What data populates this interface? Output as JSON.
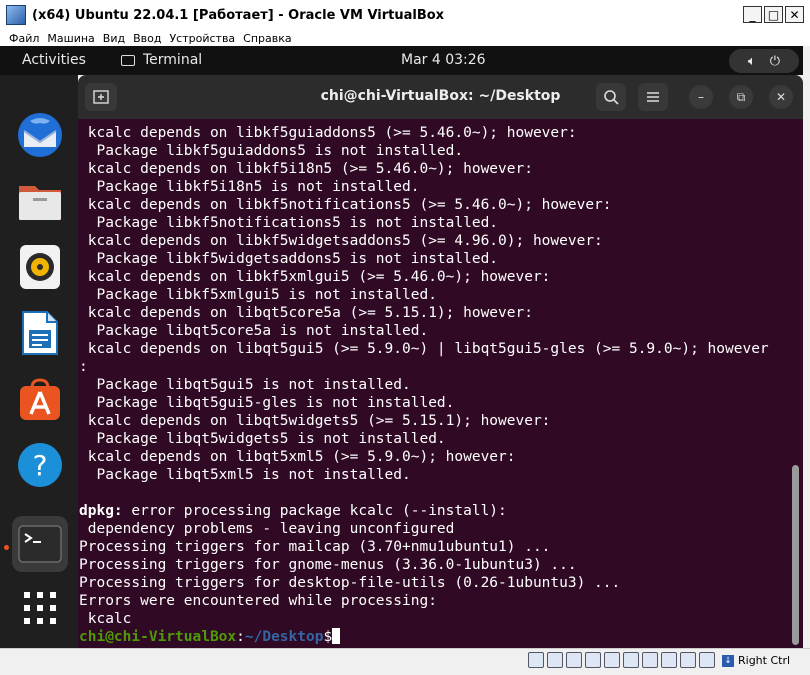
{
  "vbox": {
    "title": "(x64) Ubuntu 22.04.1 [Работает] - Oracle VM VirtualBox",
    "menu": [
      "Файл",
      "Машина",
      "Вид",
      "Ввод",
      "Устройства",
      "Справка"
    ],
    "status_host_key": "Right Ctrl",
    "status_icons": [
      "hard-disk-icon",
      "optical-disk-icon",
      "audio-icon",
      "network-icon",
      "usb-icon",
      "shared-folders-icon",
      "display-icon",
      "video-capture-icon",
      "cpu-icon",
      "mouse-integration-icon"
    ]
  },
  "ubuntu": {
    "activities": "Activities",
    "app_name": "Terminal",
    "clock": "Mar 4  03:26",
    "dock": [
      "thunderbird-icon",
      "files-icon",
      "rhythmbox-icon",
      "libreoffice-writer-icon",
      "app-center-icon",
      "help-icon",
      "terminal-icon",
      "show-apps-icon"
    ]
  },
  "terminal": {
    "title": "chi@chi-VirtualBox: ~/Desktop",
    "lines": [
      " kcalc depends on libkf5guiaddons5 (>= 5.46.0~); however:",
      "  Package libkf5guiaddons5 is not installed.",
      " kcalc depends on libkf5i18n5 (>= 5.46.0~); however:",
      "  Package libkf5i18n5 is not installed.",
      " kcalc depends on libkf5notifications5 (>= 5.46.0~); however:",
      "  Package libkf5notifications5 is not installed.",
      " kcalc depends on libkf5widgetsaddons5 (>= 4.96.0); however:",
      "  Package libkf5widgetsaddons5 is not installed.",
      " kcalc depends on libkf5xmlgui5 (>= 5.46.0~); however:",
      "  Package libkf5xmlgui5 is not installed.",
      " kcalc depends on libqt5core5a (>= 5.15.1); however:",
      "  Package libqt5core5a is not installed.",
      " kcalc depends on libqt5gui5 (>= 5.9.0~) | libqt5gui5-gles (>= 5.9.0~); however",
      ":",
      "  Package libqt5gui5 is not installed.",
      "  Package libqt5gui5-gles is not installed.",
      " kcalc depends on libqt5widgets5 (>= 5.15.1); however:",
      "  Package libqt5widgets5 is not installed.",
      " kcalc depends on libqt5xml5 (>= 5.9.0~); however:",
      "  Package libqt5xml5 is not installed.",
      "",
      "dpkg: error processing package kcalc (--install):",
      " dependency problems - leaving unconfigured",
      "Processing triggers for mailcap (3.70+nmu1ubuntu1) ...",
      "Processing triggers for gnome-menus (3.36.0-1ubuntu3) ...",
      "Processing triggers for desktop-file-utils (0.26-1ubuntu3) ...",
      "Errors were encountered while processing:",
      " kcalc"
    ],
    "dpkg_prefix": "dpkg:",
    "prompt_user": "chi@chi-VirtualBox",
    "prompt_sep": ":",
    "prompt_path": "~/Desktop",
    "prompt_end": "$"
  }
}
